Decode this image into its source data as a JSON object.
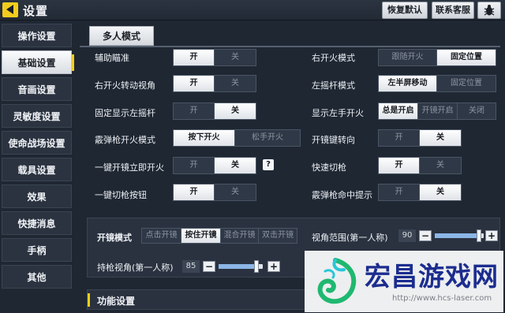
{
  "header": {
    "title": "设置",
    "restore_default": "恢复默认",
    "contact_support": "联系客服"
  },
  "sidebar": {
    "items": [
      {
        "label": "操作设置",
        "active": false
      },
      {
        "label": "基础设置",
        "active": true
      },
      {
        "label": "音画设置",
        "active": false
      },
      {
        "label": "灵敏度设置",
        "active": false
      },
      {
        "label": "使命战场设置",
        "active": false
      },
      {
        "label": "载具设置",
        "active": false
      },
      {
        "label": "效果",
        "active": false
      },
      {
        "label": "快捷消息",
        "active": false
      },
      {
        "label": "手柄",
        "active": false
      },
      {
        "label": "其他",
        "active": false
      }
    ]
  },
  "mode_tab": "多人模式",
  "settings": {
    "aim_assist": {
      "label": "辅助瞄准",
      "options": [
        "开",
        "关"
      ],
      "selected": 0
    },
    "right_fire_rotate": {
      "label": "右开火转动视角",
      "options": [
        "开",
        "关"
      ],
      "selected": 0
    },
    "fixed_left_stick": {
      "label": "固定显示左摇杆",
      "options": [
        "开",
        "关"
      ],
      "selected": 1
    },
    "shotgun_fire_mode": {
      "label": "霰弹枪开火模式",
      "options": [
        "按下开火",
        "松手开火"
      ],
      "selected": 0
    },
    "scope_instant_fire": {
      "label": "一键开镜立即开火",
      "options": [
        "开",
        "关"
      ],
      "selected": 1
    },
    "one_key_switch_gun": {
      "label": "一键切枪按钮",
      "options": [
        "开",
        "关"
      ],
      "selected": 0
    },
    "right_fire_mode": {
      "label": "右开火模式",
      "options": [
        "跟随开火",
        "固定位置"
      ],
      "selected": 1
    },
    "left_stick_mode": {
      "label": "左摇杆模式",
      "options": [
        "左半屏移动",
        "固定位置"
      ],
      "selected": 0
    },
    "show_left_fire": {
      "label": "显示左手开火",
      "options": [
        "总是开启",
        "开镜开启",
        "关闭"
      ],
      "selected": 0
    },
    "scope_key_turn": {
      "label": "开镜键转向",
      "options": [
        "开",
        "关"
      ],
      "selected": 1
    },
    "quick_switch_gun": {
      "label": "快速切枪",
      "options": [
        "开",
        "关"
      ],
      "selected": 0
    },
    "shotgun_hit_hint": {
      "label": "霰弹枪命中提示",
      "options": [
        "开",
        "关"
      ],
      "selected": 1
    }
  },
  "help_icon": "?",
  "lower": {
    "scope_mode": {
      "label": "开镜模式",
      "options": [
        "点击开镜",
        "按住开镜",
        "混合开镜",
        "双击开镜"
      ],
      "selected": 1
    },
    "fov": {
      "label": "视角范围(第一人称)",
      "value": "90",
      "fraction": 0.9
    },
    "gun_view": {
      "label": "持枪视角(第一人称)",
      "value": "85",
      "fraction": 0.85
    }
  },
  "function_settings": "功能设置",
  "stepper": {
    "minus": "−",
    "plus": "+"
  },
  "watermark": {
    "text": "宏昌游戏网",
    "url": "http://www.hcs-laser.com"
  },
  "colors": {
    "accent": "#f3cd1d",
    "background": "#1f2733",
    "on_segment": "#ffffff",
    "slider_fill": "#8bb6e6"
  }
}
